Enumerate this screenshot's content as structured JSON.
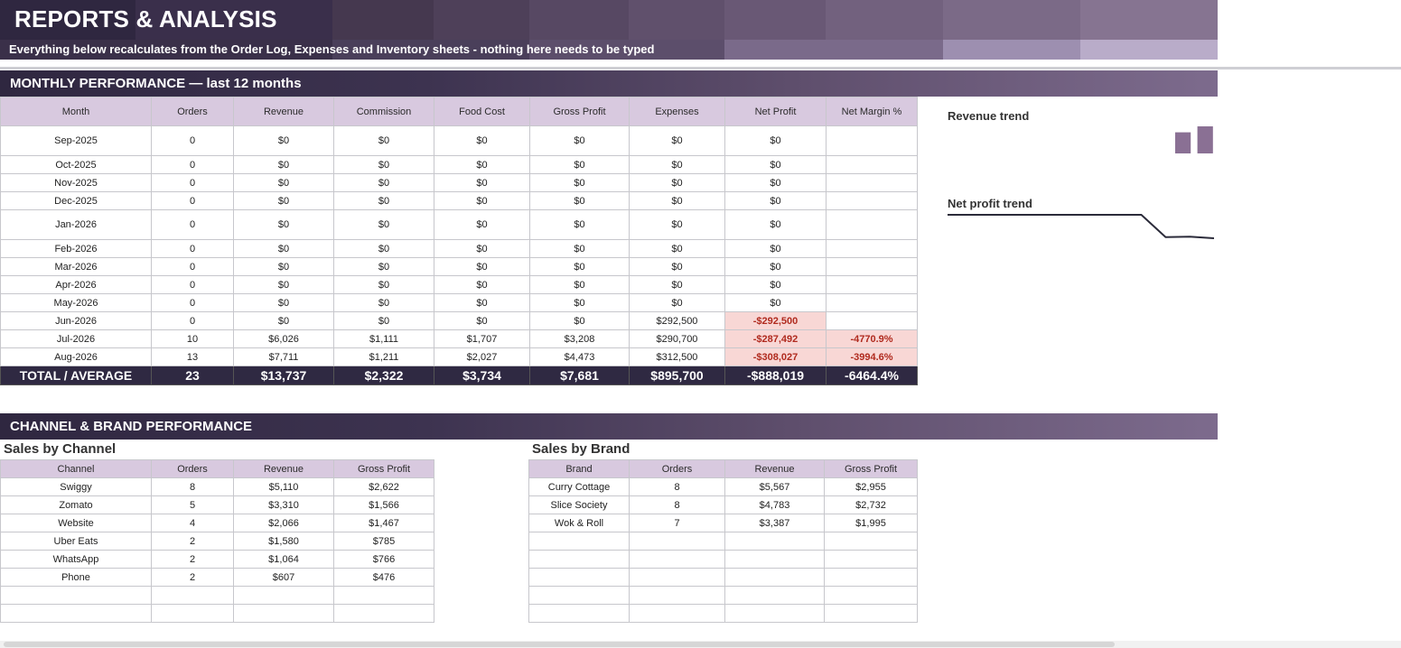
{
  "header": {
    "title": "REPORTS & ANALYSIS",
    "subtitle": "Everything below recalculates from the Order Log, Expenses and Inventory sheets - nothing here needs to be typed"
  },
  "monthly": {
    "section_title": "MONTHLY PERFORMANCE  —  last 12 months",
    "columns": [
      "Month",
      "Orders",
      "Revenue",
      "Commission",
      "Food Cost",
      "Gross Profit",
      "Expenses",
      "Net Profit",
      "Net Margin %"
    ],
    "rows": [
      [
        "Sep-2025",
        "0",
        "$0",
        "$0",
        "$0",
        "$0",
        "$0",
        "$0",
        ""
      ],
      [
        "Oct-2025",
        "0",
        "$0",
        "$0",
        "$0",
        "$0",
        "$0",
        "$0",
        ""
      ],
      [
        "Nov-2025",
        "0",
        "$0",
        "$0",
        "$0",
        "$0",
        "$0",
        "$0",
        ""
      ],
      [
        "Dec-2025",
        "0",
        "$0",
        "$0",
        "$0",
        "$0",
        "$0",
        "$0",
        ""
      ],
      [
        "Jan-2026",
        "0",
        "$0",
        "$0",
        "$0",
        "$0",
        "$0",
        "$0",
        ""
      ],
      [
        "Feb-2026",
        "0",
        "$0",
        "$0",
        "$0",
        "$0",
        "$0",
        "$0",
        ""
      ],
      [
        "Mar-2026",
        "0",
        "$0",
        "$0",
        "$0",
        "$0",
        "$0",
        "$0",
        ""
      ],
      [
        "Apr-2026",
        "0",
        "$0",
        "$0",
        "$0",
        "$0",
        "$0",
        "$0",
        ""
      ],
      [
        "May-2026",
        "0",
        "$0",
        "$0",
        "$0",
        "$0",
        "$0",
        "$0",
        ""
      ],
      [
        "Jun-2026",
        "0",
        "$0",
        "$0",
        "$0",
        "$0",
        "$292,500",
        "-$292,500",
        ""
      ],
      [
        "Jul-2026",
        "10",
        "$6,026",
        "$1,111",
        "$1,707",
        "$3,208",
        "$290,700",
        "-$287,492",
        "-4770.9%"
      ],
      [
        "Aug-2026",
        "13",
        "$7,711",
        "$1,211",
        "$2,027",
        "$4,473",
        "$312,500",
        "-$308,027",
        "-3994.6%"
      ]
    ],
    "total": [
      "TOTAL / AVERAGE",
      "23",
      "$13,737",
      "$2,322",
      "$3,734",
      "$7,681",
      "$895,700",
      "-$888,019",
      "-6464.4%"
    ]
  },
  "sparklines": {
    "revenue_label": "Revenue trend",
    "net_profit_label": "Net profit trend",
    "revenue_values": [
      0,
      0,
      0,
      0,
      0,
      0,
      0,
      0,
      0,
      0,
      6026,
      7711
    ],
    "net_profit_values": [
      0,
      0,
      0,
      0,
      0,
      0,
      0,
      0,
      0,
      -292500,
      -287492,
      -308027
    ],
    "bar_color": "#8a7094",
    "line_color": "#2b2b3a"
  },
  "channel_brand": {
    "section_title": "CHANNEL  &  BRAND PERFORMANCE",
    "channel_heading": "Sales by Channel",
    "brand_heading": "Sales by Brand",
    "channel_columns": [
      "Channel",
      "Orders",
      "Revenue",
      "Gross Profit"
    ],
    "channel_rows": [
      [
        "Swiggy",
        "8",
        "$5,110",
        "$2,622"
      ],
      [
        "Zomato",
        "5",
        "$3,310",
        "$1,566"
      ],
      [
        "Website",
        "4",
        "$2,066",
        "$1,467"
      ],
      [
        "Uber Eats",
        "2",
        "$1,580",
        "$785"
      ],
      [
        "WhatsApp",
        "2",
        "$1,064",
        "$766"
      ],
      [
        "Phone",
        "2",
        "$607",
        "$476"
      ],
      [
        "",
        "",
        "",
        ""
      ],
      [
        "",
        "",
        "",
        ""
      ]
    ],
    "brand_columns": [
      "Brand",
      "Orders",
      "Revenue",
      "Gross Profit"
    ],
    "brand_rows": [
      [
        "Curry Cottage",
        "8",
        "$5,567",
        "$2,955"
      ],
      [
        "Slice Society",
        "8",
        "$4,783",
        "$2,732"
      ],
      [
        "Wok & Roll",
        "7",
        "$3,387",
        "$1,995"
      ],
      [
        "",
        "",
        "",
        ""
      ],
      [
        "",
        "",
        "",
        ""
      ],
      [
        "",
        "",
        "",
        ""
      ],
      [
        "",
        "",
        "",
        ""
      ],
      [
        "",
        "",
        "",
        ""
      ]
    ]
  }
}
